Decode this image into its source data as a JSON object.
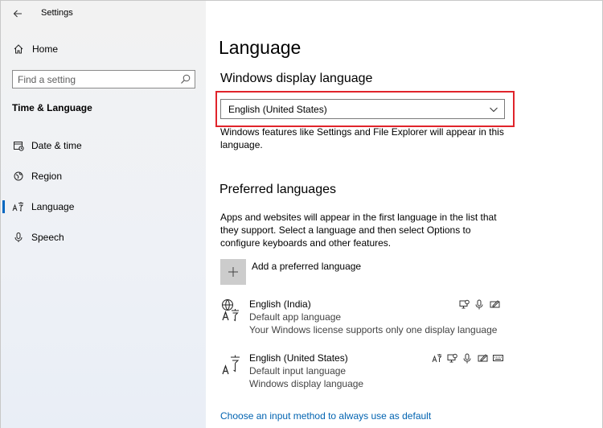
{
  "window": {
    "title": "Settings"
  },
  "sidebar": {
    "home_label": "Home",
    "search": {
      "placeholder": "Find a setting"
    },
    "section_heading": "Time & Language",
    "items": [
      {
        "label": "Date & time",
        "icon": "calendar-icon"
      },
      {
        "label": "Region",
        "icon": "region-icon"
      },
      {
        "label": "Language",
        "icon": "language-icon",
        "active": true
      },
      {
        "label": "Speech",
        "icon": "microphone-icon"
      }
    ]
  },
  "main": {
    "title": "Language",
    "display_language": {
      "heading": "Windows display language",
      "selected": "English (United States)",
      "description": "Windows features like Settings and File Explorer will appear in this language."
    },
    "preferred": {
      "heading": "Preferred languages",
      "description": "Apps and websites will appear in the first language in the list that they support. Select a language and then select Options to configure keyboards and other features.",
      "add_label": "Add a preferred language",
      "languages": [
        {
          "name": "English (India)",
          "line1": "Default app language",
          "line2": "Your Windows license supports only one display language"
        },
        {
          "name": "English (United States)",
          "line1": "Default input language",
          "line2": "Windows display language"
        }
      ]
    },
    "link_label": "Choose an input method to always use as default"
  },
  "colors": {
    "accent": "#0067c0",
    "highlight": "#e0242b",
    "link": "#0063b1"
  }
}
